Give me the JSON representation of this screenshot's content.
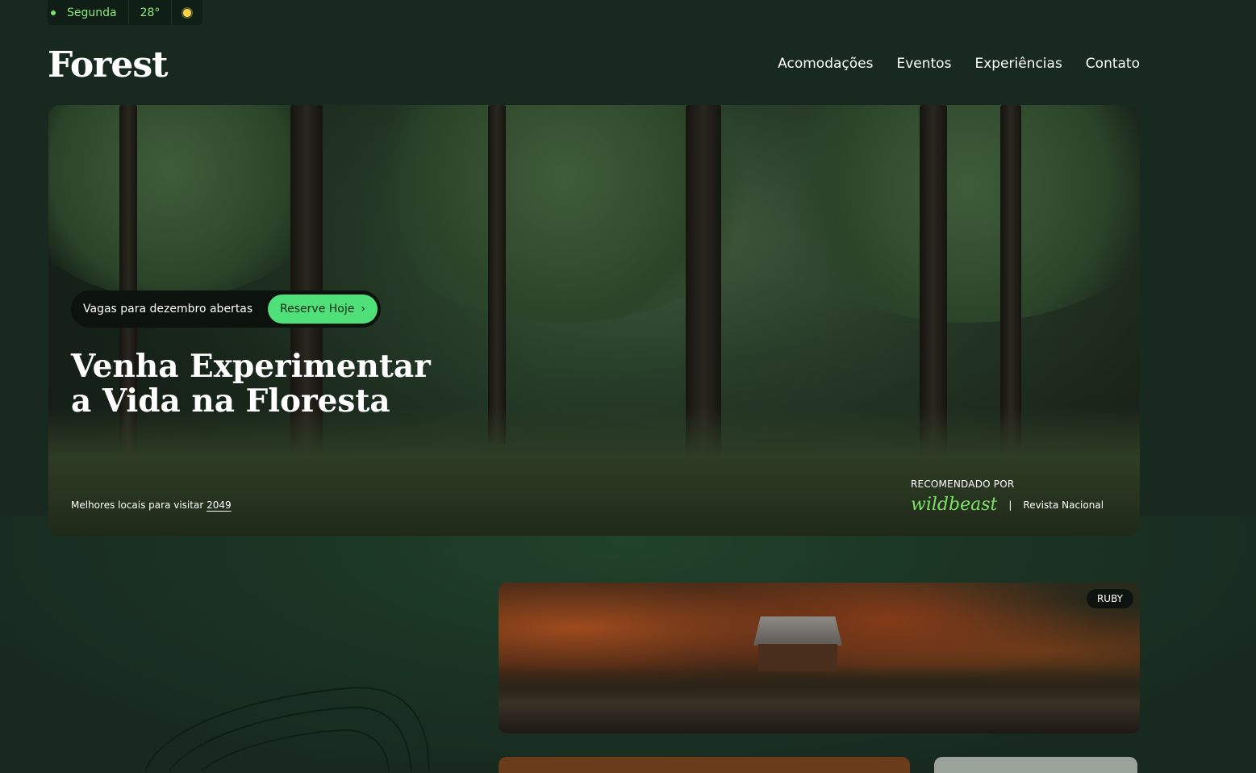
{
  "topbar": {
    "day": "Segunda",
    "temperature": "28°",
    "weather_icon": "sun-icon"
  },
  "header": {
    "logo": "Forest",
    "nav": [
      "Acomodações",
      "Eventos",
      "Experiências",
      "Contato"
    ]
  },
  "hero": {
    "pill_text": "Vagas para dezembro abertas",
    "pill_button": "Reserve Hoje",
    "headline_line1": "Venha Experimentar",
    "headline_line2": "a Vida na Floresta",
    "bottom_text": "Melhores locais para visitar",
    "bottom_year": "2049",
    "recommended_label": "RECOMENDADO POR",
    "brand": "wildbeast",
    "separator": "|",
    "publication": "Revista Nacional"
  },
  "cards": [
    {
      "badge": "RUBY"
    }
  ],
  "colors": {
    "background": "#182a20",
    "accent": "#4fe07a",
    "accent_text": "#7fe06a"
  }
}
